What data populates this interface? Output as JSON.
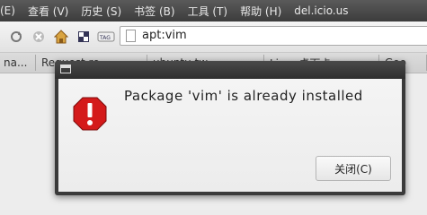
{
  "menubar": {
    "items": [
      "(E)",
      "查看 (V)",
      "历史 (S)",
      "书签 (B)",
      "工具 (T)",
      "帮助 (H)",
      "del.icio.us"
    ]
  },
  "navbar": {
    "url": "apt:vim",
    "icons": [
      "reload-icon",
      "stop-icon",
      "home-icon",
      "bookmark-icon",
      "tag-icon"
    ]
  },
  "tabs": [
    "na...",
    "Request re...",
    "ubuntu tw...",
    "Linux桌面卡...",
    "Goo"
  ],
  "dialog": {
    "message": "Package 'vim' is already installed",
    "close_button": "关闭(C)"
  }
}
